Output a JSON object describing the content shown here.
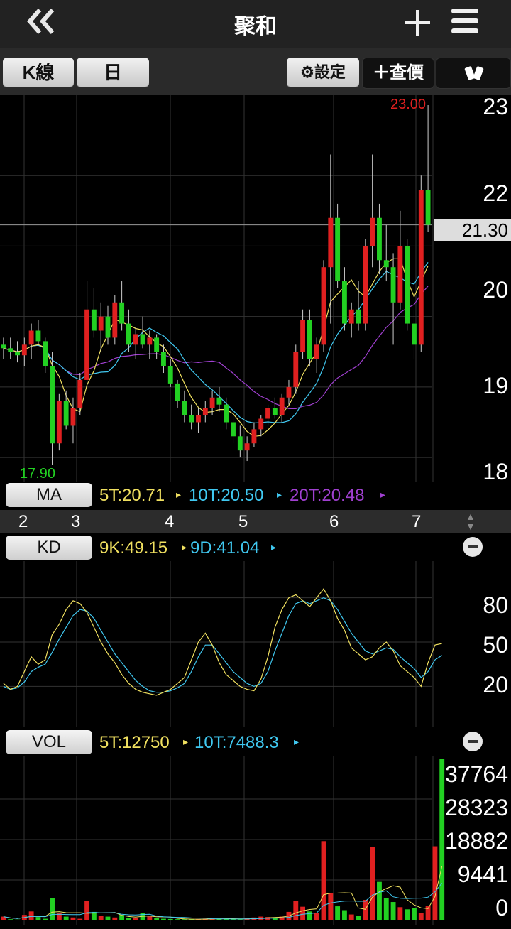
{
  "header": {
    "title": "聚和",
    "back_icon": "double-chevron-left-icon",
    "add_icon": "plus-icon",
    "menu_icon": "hamburger-menu-icon"
  },
  "toolbar": {
    "kline_label": "K線",
    "period_label": "日",
    "settings_label": "設定",
    "quote_label": "查價",
    "rotate_icon": "rotate-screen-icon"
  },
  "colors": {
    "up": "#e02020",
    "down": "#22d022",
    "ma5": "#f0e060",
    "ma10": "#40c8f0",
    "ma20": "#a040d0"
  },
  "price": {
    "yticks": [
      "23",
      "22",
      "21.30",
      "20",
      "19",
      "18"
    ],
    "high_label": "23.00",
    "low_label": "17.90",
    "current": "21.30",
    "ylim": [
      17.9,
      23.0
    ]
  },
  "ma": {
    "button": "MA",
    "ma5": "5T:20.71",
    "ma10": "10T:20.50",
    "ma20": "20T:20.48"
  },
  "dates": [
    "2",
    "3",
    "4",
    "5",
    "6",
    "7"
  ],
  "kd": {
    "button": "KD",
    "k": "9K:49.15",
    "d": "9D:41.04",
    "yticks": [
      "80",
      "50",
      "20"
    ]
  },
  "vol": {
    "button": "VOL",
    "v5": "5T:12750",
    "v10": "10T:7488.3",
    "yticks": [
      "37764",
      "28323",
      "18882",
      "9441",
      "0"
    ]
  },
  "chart_data": {
    "type": "candlestick",
    "title": "",
    "ylim": [
      17.9,
      23.0
    ],
    "candles": [
      {
        "o": 19.6,
        "h": 19.7,
        "l": 19.4,
        "c": 19.55
      },
      {
        "o": 19.55,
        "h": 19.7,
        "l": 19.4,
        "c": 19.5
      },
      {
        "o": 19.5,
        "h": 19.65,
        "l": 19.35,
        "c": 19.45
      },
      {
        "o": 19.45,
        "h": 19.7,
        "l": 19.3,
        "c": 19.6
      },
      {
        "o": 19.6,
        "h": 19.9,
        "l": 19.4,
        "c": 19.8
      },
      {
        "o": 19.8,
        "h": 19.95,
        "l": 19.6,
        "c": 19.65
      },
      {
        "o": 19.65,
        "h": 19.7,
        "l": 19.2,
        "c": 19.3
      },
      {
        "o": 19.3,
        "h": 19.5,
        "l": 17.9,
        "c": 18.2
      },
      {
        "o": 18.2,
        "h": 18.9,
        "l": 18.1,
        "c": 18.8
      },
      {
        "o": 18.8,
        "h": 18.95,
        "l": 18.4,
        "c": 18.45
      },
      {
        "o": 18.45,
        "h": 18.85,
        "l": 18.2,
        "c": 18.7
      },
      {
        "o": 18.7,
        "h": 19.2,
        "l": 18.6,
        "c": 19.1
      },
      {
        "o": 19.1,
        "h": 20.5,
        "l": 19.0,
        "c": 20.1
      },
      {
        "o": 20.1,
        "h": 20.4,
        "l": 19.7,
        "c": 19.8
      },
      {
        "o": 19.8,
        "h": 20.2,
        "l": 19.5,
        "c": 20.0
      },
      {
        "o": 20.0,
        "h": 20.15,
        "l": 19.6,
        "c": 19.7
      },
      {
        "o": 19.7,
        "h": 20.3,
        "l": 19.6,
        "c": 20.2
      },
      {
        "o": 20.2,
        "h": 20.5,
        "l": 19.8,
        "c": 19.9
      },
      {
        "o": 19.9,
        "h": 20.1,
        "l": 19.5,
        "c": 19.6
      },
      {
        "o": 19.6,
        "h": 19.85,
        "l": 19.4,
        "c": 19.75
      },
      {
        "o": 19.75,
        "h": 20.0,
        "l": 19.55,
        "c": 19.6
      },
      {
        "o": 19.6,
        "h": 19.8,
        "l": 19.4,
        "c": 19.7
      },
      {
        "o": 19.7,
        "h": 19.75,
        "l": 19.4,
        "c": 19.5
      },
      {
        "o": 19.5,
        "h": 19.6,
        "l": 19.2,
        "c": 19.3
      },
      {
        "o": 19.3,
        "h": 19.4,
        "l": 19.0,
        "c": 19.05
      },
      {
        "o": 19.05,
        "h": 19.1,
        "l": 18.7,
        "c": 18.8
      },
      {
        "o": 18.8,
        "h": 18.95,
        "l": 18.5,
        "c": 18.6
      },
      {
        "o": 18.6,
        "h": 18.75,
        "l": 18.4,
        "c": 18.5
      },
      {
        "o": 18.5,
        "h": 18.7,
        "l": 18.35,
        "c": 18.6
      },
      {
        "o": 18.6,
        "h": 18.8,
        "l": 18.5,
        "c": 18.7
      },
      {
        "o": 18.7,
        "h": 18.95,
        "l": 18.6,
        "c": 18.85
      },
      {
        "o": 18.85,
        "h": 19.0,
        "l": 18.65,
        "c": 18.75
      },
      {
        "o": 18.75,
        "h": 18.85,
        "l": 18.4,
        "c": 18.5
      },
      {
        "o": 18.5,
        "h": 18.65,
        "l": 18.2,
        "c": 18.3
      },
      {
        "o": 18.3,
        "h": 18.45,
        "l": 18.0,
        "c": 18.1
      },
      {
        "o": 18.1,
        "h": 18.3,
        "l": 17.95,
        "c": 18.2
      },
      {
        "o": 18.2,
        "h": 18.5,
        "l": 18.15,
        "c": 18.4
      },
      {
        "o": 18.4,
        "h": 18.6,
        "l": 18.3,
        "c": 18.55
      },
      {
        "o": 18.55,
        "h": 18.75,
        "l": 18.45,
        "c": 18.7
      },
      {
        "o": 18.7,
        "h": 18.85,
        "l": 18.55,
        "c": 18.6
      },
      {
        "o": 18.6,
        "h": 18.9,
        "l": 18.5,
        "c": 18.85
      },
      {
        "o": 18.85,
        "h": 19.1,
        "l": 18.75,
        "c": 19.0
      },
      {
        "o": 19.0,
        "h": 19.6,
        "l": 18.9,
        "c": 19.5
      },
      {
        "o": 19.5,
        "h": 20.1,
        "l": 19.4,
        "c": 19.95
      },
      {
        "o": 19.95,
        "h": 20.1,
        "l": 19.3,
        "c": 19.4
      },
      {
        "o": 19.4,
        "h": 19.7,
        "l": 19.2,
        "c": 19.6
      },
      {
        "o": 19.6,
        "h": 20.8,
        "l": 19.5,
        "c": 20.7
      },
      {
        "o": 20.7,
        "h": 22.3,
        "l": 19.9,
        "c": 21.4
      },
      {
        "o": 21.4,
        "h": 21.6,
        "l": 20.4,
        "c": 20.5
      },
      {
        "o": 20.5,
        "h": 20.7,
        "l": 19.8,
        "c": 19.9
      },
      {
        "o": 19.9,
        "h": 20.2,
        "l": 19.7,
        "c": 20.1
      },
      {
        "o": 20.1,
        "h": 20.5,
        "l": 19.8,
        "c": 19.9
      },
      {
        "o": 19.9,
        "h": 21.1,
        "l": 19.8,
        "c": 21.0
      },
      {
        "o": 21.0,
        "h": 22.3,
        "l": 20.7,
        "c": 21.4
      },
      {
        "o": 21.4,
        "h": 21.6,
        "l": 20.6,
        "c": 20.8
      },
      {
        "o": 20.8,
        "h": 21.3,
        "l": 20.5,
        "c": 20.7
      },
      {
        "o": 20.7,
        "h": 20.9,
        "l": 19.6,
        "c": 20.2
      },
      {
        "o": 20.2,
        "h": 21.5,
        "l": 20.1,
        "c": 21.0
      },
      {
        "o": 21.0,
        "h": 21.1,
        "l": 19.8,
        "c": 19.9
      },
      {
        "o": 19.9,
        "h": 20.1,
        "l": 19.4,
        "c": 19.6
      },
      {
        "o": 19.6,
        "h": 22.0,
        "l": 19.5,
        "c": 21.8
      },
      {
        "o": 21.8,
        "h": 23.0,
        "l": 21.2,
        "c": 21.3
      }
    ],
    "kd": {
      "k": [
        22,
        18,
        20,
        30,
        40,
        35,
        38,
        55,
        62,
        72,
        78,
        76,
        70,
        60,
        50,
        42,
        36,
        28,
        22,
        18,
        16,
        15,
        14,
        16,
        18,
        22,
        26,
        38,
        50,
        56,
        48,
        36,
        28,
        24,
        20,
        18,
        17,
        25,
        40,
        60,
        72,
        80,
        82,
        78,
        74,
        80,
        86,
        78,
        66,
        58,
        46,
        42,
        38,
        40,
        46,
        50,
        44,
        34,
        30,
        26,
        20,
        36,
        48,
        49
      ],
      "d": [
        20,
        18,
        19,
        23,
        30,
        33,
        35,
        43,
        52,
        60,
        68,
        72,
        71,
        66,
        58,
        50,
        42,
        36,
        30,
        24,
        20,
        17,
        16,
        16,
        17,
        19,
        22,
        30,
        40,
        48,
        48,
        42,
        36,
        30,
        26,
        22,
        20,
        22,
        30,
        44,
        56,
        68,
        76,
        78,
        76,
        78,
        80,
        78,
        72,
        64,
        56,
        50,
        44,
        42,
        44,
        46,
        45,
        40,
        36,
        32,
        26,
        30,
        38,
        41
      ]
    },
    "volume": [
      900,
      300,
      200,
      1300,
      2100,
      800,
      400,
      5200,
      1800,
      900,
      700,
      400,
      4600,
      2000,
      1100,
      900,
      700,
      1300,
      600,
      500,
      1800,
      900,
      500,
      400,
      350,
      300,
      300,
      250,
      300,
      400,
      500,
      450,
      380,
      300,
      250,
      500,
      700,
      900,
      800,
      600,
      900,
      2000,
      4600,
      3200,
      2100,
      1700,
      18500,
      6400,
      3300,
      2400,
      1400,
      1100,
      4800,
      17200,
      9000,
      5200,
      4300,
      3100,
      2600,
      2900,
      1800,
      3400,
      17300,
      37764
    ],
    "volume_up": [
      true,
      false,
      false,
      true,
      true,
      false,
      false,
      false,
      true,
      false,
      true,
      true,
      true,
      false,
      true,
      false,
      true,
      false,
      false,
      true,
      false,
      true,
      false,
      false,
      false,
      false,
      false,
      false,
      true,
      true,
      true,
      false,
      false,
      false,
      false,
      true,
      true,
      true,
      true,
      false,
      true,
      true,
      true,
      true,
      false,
      true,
      true,
      true,
      false,
      false,
      true,
      false,
      true,
      true,
      false,
      false,
      false,
      true,
      false,
      false,
      true,
      true,
      true,
      false
    ]
  }
}
